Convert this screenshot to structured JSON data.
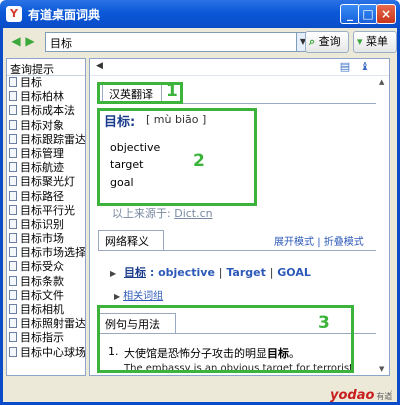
{
  "window": {
    "title": "有道桌面词典",
    "app_icon": "Y"
  },
  "toolbar": {
    "search_value": "目标",
    "query_label": "查询",
    "menu_label": "菜单"
  },
  "suggestions": {
    "header": "查询提示",
    "items": [
      "目标",
      "目标柏林",
      "目标成本法",
      "目标对象",
      "目标跟踪雷达",
      "目标管理",
      "目标航迹",
      "目标聚光灯",
      "目标路径",
      "目标平行光",
      "目标识别",
      "目标市场",
      "目标市场选择",
      "目标受众",
      "目标条款",
      "目标文件",
      "目标相机",
      "目标照射雷达",
      "目标指示",
      "目标中心球场"
    ]
  },
  "content": {
    "tab_translate": "汉英翻译",
    "headword": "目标:",
    "phonetic": "[ mù biāo ]",
    "translations": [
      "objective",
      "target",
      "goal"
    ],
    "source_prefix": "以上来源于:",
    "source_link": "Dict.cn",
    "tab_web": "网络释义",
    "expand_mode": "展开模式",
    "collapse_mode": "折叠模式",
    "web_headword": "目标",
    "web_colon": ":",
    "web_terms": [
      "objective",
      "Target",
      "GOAL"
    ],
    "related_label": "相关词组",
    "tab_examples": "例句与用法",
    "example_num": "1.",
    "example_zh_pre": "大使馆是恐怖分子攻击的明显",
    "example_zh_bold": "目标",
    "example_zh_post": "。",
    "example_en": "The embassy is an obvious target for terrorist"
  },
  "annotations": [
    "1",
    "2",
    "3"
  ],
  "branding": {
    "logo": "yodao",
    "logo_sub": "有道"
  },
  "colors": {
    "annotation": "#3cb43c",
    "title_bar": "#0a58d8",
    "link": "#2d5ab8"
  }
}
